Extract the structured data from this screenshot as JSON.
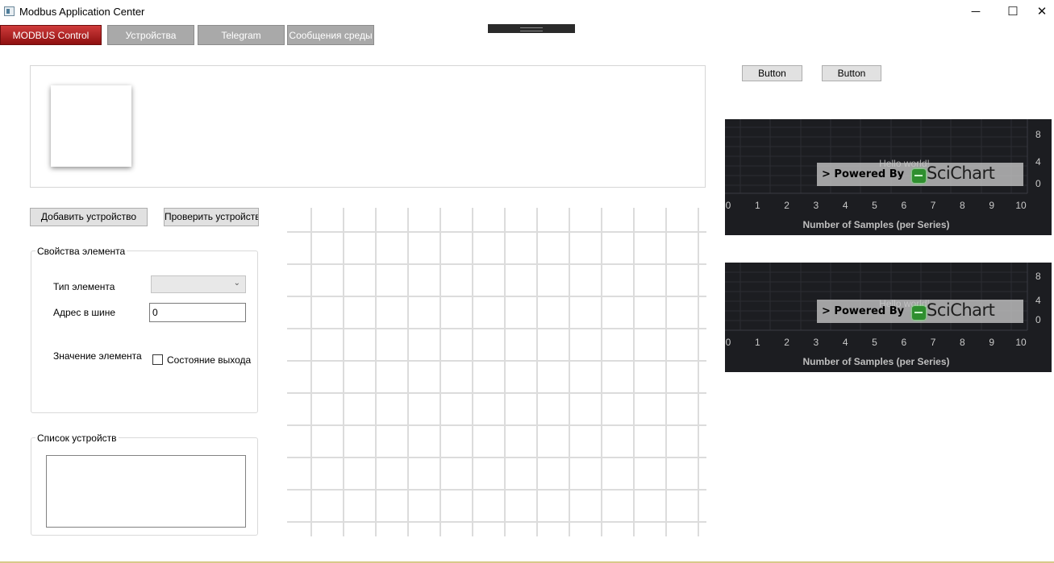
{
  "window": {
    "title": "Modbus Application Center",
    "minimize_glyph": "─",
    "maximize_glyph": "☐",
    "close_glyph": "✕"
  },
  "tabs": [
    {
      "label": "MODBUS Control",
      "active": true
    },
    {
      "label": "Устройства",
      "active": false
    },
    {
      "label": "Telegram",
      "active": false
    },
    {
      "label": "Сообщения среды",
      "active": false
    }
  ],
  "top_buttons": [
    {
      "label": "Button"
    },
    {
      "label": "Button"
    }
  ],
  "actions": {
    "add_device": "Добавить устройство",
    "check_device": "Проверить устройств"
  },
  "properties": {
    "group_title": "Свойства элемента",
    "element_type_label": "Тип элемента",
    "element_type_value": "",
    "bus_address_label": "Адрес в шине",
    "bus_address_value": "0",
    "element_value_label": "Значение элемента",
    "output_state_label": "Состояние выхода",
    "output_state_checked": false
  },
  "devices": {
    "group_title": "Список устройств",
    "items": []
  },
  "charts": [
    {
      "chart_data": {
        "type": "line",
        "title": "Hello world!",
        "xlabel": "Number of Samples (per Series)",
        "ylabel": "",
        "xlim": [
          0,
          10
        ],
        "ylim": [
          0,
          8
        ],
        "x_ticks": [
          "0",
          "1",
          "2",
          "3",
          "4",
          "5",
          "6",
          "7",
          "8",
          "9",
          "10"
        ],
        "y_ticks": [
          "8",
          "4",
          "0"
        ],
        "series": [],
        "grid": true,
        "watermark": {
          "powered": "> Powered By",
          "brand": "SciChart"
        }
      }
    },
    {
      "chart_data": {
        "type": "line",
        "title": "Hello world!",
        "xlabel": "Number of Samples (per Series)",
        "ylabel": "",
        "xlim": [
          0,
          10
        ],
        "ylim": [
          0,
          8
        ],
        "x_ticks": [
          "0",
          "1",
          "2",
          "3",
          "4",
          "5",
          "6",
          "7",
          "8",
          "9",
          "10"
        ],
        "y_ticks": [
          "8",
          "4",
          "0"
        ],
        "series": [],
        "grid": true,
        "watermark": {
          "powered": "> Powered By",
          "brand": "SciChart"
        }
      }
    }
  ],
  "colors": {
    "active_tab": "#a91f1f",
    "inactive_tab": "#a9a9a9",
    "chart_background": "#1c1d21",
    "grid_lines": "#dcdcdc"
  }
}
